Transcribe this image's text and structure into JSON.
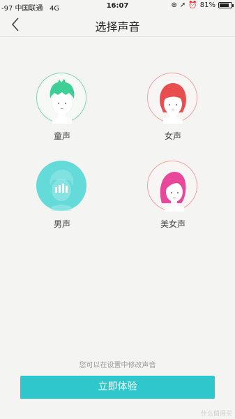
{
  "status_bar": {
    "carrier": "-97 中国联通",
    "network": "4G",
    "time": "16:07",
    "battery": "81%",
    "battery_level": 0.81
  },
  "header": {
    "title": "选择声音"
  },
  "voices": [
    {
      "label": "童声",
      "icon": "child-face-icon"
    },
    {
      "label": "女声",
      "icon": "woman-face-icon"
    },
    {
      "label": "男声",
      "icon": "man-face-icon",
      "selected": true
    },
    {
      "label": "美女声",
      "icon": "beauty-face-icon"
    }
  ],
  "hint": "您可以在设置中修改声音",
  "cta_label": "立即体验",
  "watermark": "什么值得买",
  "colors": {
    "accent": "#2ec8cc",
    "selected_circle": "#64dad9",
    "green_ring": "#7fd6b0",
    "red_ring": "#f0a2a2"
  }
}
